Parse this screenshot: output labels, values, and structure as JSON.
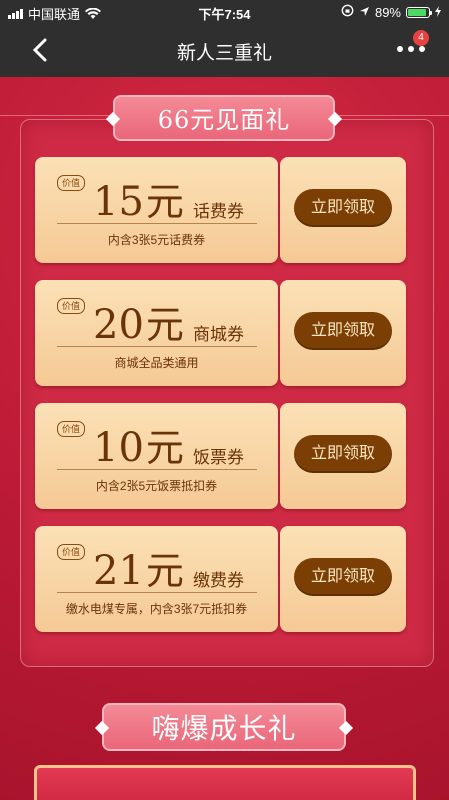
{
  "status_bar": {
    "carrier": "中国联通",
    "time": "下午7:54",
    "battery": "89%"
  },
  "nav": {
    "title": "新人三重礼",
    "badge_count": "4"
  },
  "sections": {
    "gift_66_title": "66元见面礼",
    "growth_title": "嗨爆成长礼"
  },
  "coupons": [
    {
      "tag": "价值",
      "amount": "15",
      "unit": "元",
      "name": "话费券",
      "desc": "内含3张5元话费券",
      "button": "立即领取"
    },
    {
      "tag": "价值",
      "amount": "20",
      "unit": "元",
      "name": "商城券",
      "desc": "商城全品类通用",
      "button": "立即领取"
    },
    {
      "tag": "价值",
      "amount": "10",
      "unit": "元",
      "name": "饭票券",
      "desc": "内含2张5元饭票抵扣券",
      "button": "立即领取"
    },
    {
      "tag": "价值",
      "amount": "21",
      "unit": "元",
      "name": "缴费券",
      "desc": "缴水电煤专属，内含3张7元抵扣券",
      "button": "立即领取"
    }
  ],
  "colors": {
    "background": "#b81935",
    "card": "#fbe1b6",
    "button": "#7b3f06"
  }
}
